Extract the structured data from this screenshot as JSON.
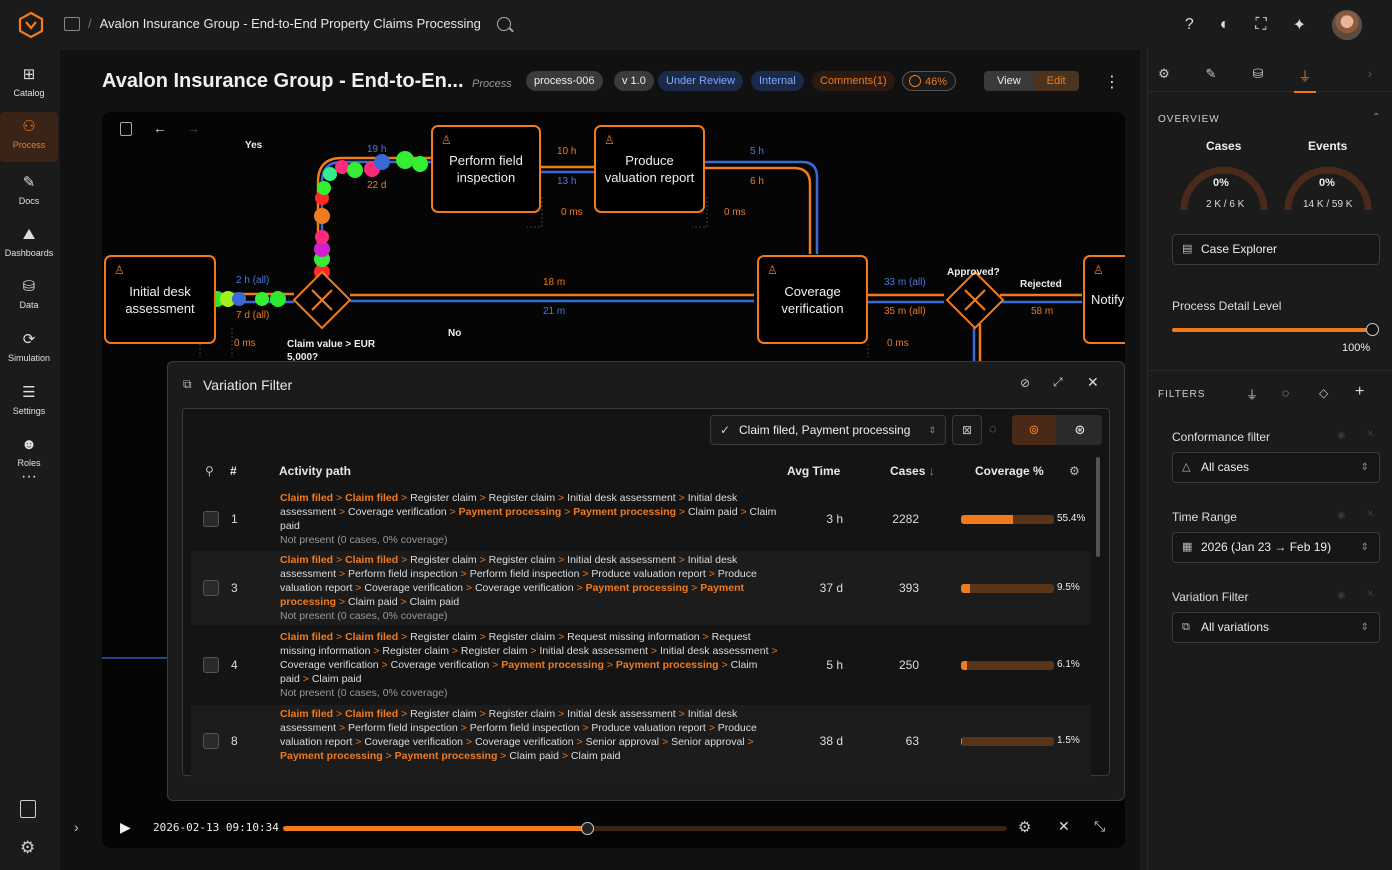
{
  "topbar": {
    "breadcrumb": "Avalon Insurance Group - End-to-End Property Claims Processing"
  },
  "nav": [
    {
      "label": "Catalog",
      "icon": "catalog-icon"
    },
    {
      "label": "Process",
      "icon": "process-icon"
    },
    {
      "label": "Docs",
      "icon": "docs-icon"
    },
    {
      "label": "Dashboards",
      "icon": "dashboards-icon"
    },
    {
      "label": "Data",
      "icon": "data-icon"
    },
    {
      "label": "Simulation",
      "icon": "simulation-icon"
    },
    {
      "label": "Settings",
      "icon": "settings-icon"
    },
    {
      "label": "Roles",
      "icon": "roles-icon"
    }
  ],
  "header": {
    "title": "Avalon Insurance Group - End-to-En...",
    "subtitle": "Process",
    "id_chip": "process-006",
    "version_chip": "v 1.0",
    "status_chip": "Under Review",
    "scope_chip": "Internal",
    "comments_chip": "Comments(1)",
    "progress_chip": "46%",
    "view_label": "View",
    "edit_label": "Edit"
  },
  "map": {
    "nodes": {
      "initial": "Initial desk assessment",
      "field": "Perform field inspection",
      "valuation": "Produce valuation report",
      "coverage": "Coverage verification",
      "notify": "Notify"
    },
    "labels": {
      "yes": "Yes",
      "no": "No",
      "gw1": "Claim value > EUR 5,000?",
      "gw2": "Approved?",
      "rejected": "Rejected",
      "l_19h": "19 h",
      "l_22d": "22 d",
      "l_10h": "10 h",
      "l_13h": "13 h",
      "l_0ms_a": "0 ms",
      "l_5h": "5 h",
      "l_6h": "6 h",
      "l_0ms_b": "0 ms",
      "l_2h": "2 h (all)",
      "l_7d": "7 d (all)",
      "l_0ms_c": "0 ms",
      "l_18m": "18 m",
      "l_21m": "21 m",
      "l_33m": "33 m (all)",
      "l_35m": "35 m (all)",
      "l_0ms_d": "0 ms",
      "l_58m": "58 m"
    }
  },
  "variation_filter": {
    "title": "Variation Filter",
    "selector": "Claim filed, Payment processing",
    "columns": {
      "num": "#",
      "path": "Activity path",
      "avg": "Avg Time",
      "cases": "Cases",
      "cases_sort": "↓",
      "coverage": "Coverage %"
    },
    "rows": [
      {
        "n": "1",
        "avg": "3 h",
        "cases": "2282",
        "coverage": 55.4,
        "coverage_label": "55.4%",
        "note": "Not present (0 cases, 0% coverage)",
        "path": [
          [
            "Claim filed",
            1
          ],
          [
            "Claim filed",
            1
          ],
          [
            "Register claim",
            0
          ],
          [
            "Register claim",
            0
          ],
          [
            "Initial desk assessment",
            0
          ],
          [
            "Initial desk assessment",
            0
          ],
          [
            "Coverage verification",
            0
          ],
          [
            "Payment processing",
            1
          ],
          [
            "Payment processing",
            1
          ],
          [
            "Claim paid",
            0
          ],
          [
            "Claim paid",
            0
          ]
        ]
      },
      {
        "n": "3",
        "avg": "37 d",
        "cases": "393",
        "coverage": 9.5,
        "coverage_label": "9.5%",
        "note": "Not present (0 cases, 0% coverage)",
        "path": [
          [
            "Claim filed",
            1
          ],
          [
            "Claim filed",
            1
          ],
          [
            "Register claim",
            0
          ],
          [
            "Register claim",
            0
          ],
          [
            "Initial desk assessment",
            0
          ],
          [
            "Initial desk assessment",
            0
          ],
          [
            "Perform field inspection",
            0
          ],
          [
            "Perform field inspection",
            0
          ],
          [
            "Produce valuation report",
            0
          ],
          [
            "Produce valuation report",
            0
          ],
          [
            "Coverage verification",
            0
          ],
          [
            "Coverage verification",
            0
          ],
          [
            "Payment processing",
            1
          ],
          [
            "Payment processing",
            1
          ],
          [
            "Claim paid",
            0
          ],
          [
            "Claim paid",
            0
          ]
        ]
      },
      {
        "n": "4",
        "avg": "5 h",
        "cases": "250",
        "coverage": 6.1,
        "coverage_label": "6.1%",
        "note": "Not present (0 cases, 0% coverage)",
        "path": [
          [
            "Claim filed",
            1
          ],
          [
            "Claim filed",
            1
          ],
          [
            "Register claim",
            0
          ],
          [
            "Register claim",
            0
          ],
          [
            "Request missing information",
            0
          ],
          [
            "Request missing information",
            0
          ],
          [
            "Register claim",
            0
          ],
          [
            "Register claim",
            0
          ],
          [
            "Initial desk assessment",
            0
          ],
          [
            "Initial desk assessment",
            0
          ],
          [
            "Coverage verification",
            0
          ],
          [
            "Coverage verification",
            0
          ],
          [
            "Payment processing",
            1
          ],
          [
            "Payment processing",
            1
          ],
          [
            "Claim paid",
            0
          ],
          [
            "Claim paid",
            0
          ]
        ]
      },
      {
        "n": "8",
        "avg": "38 d",
        "cases": "63",
        "coverage": 1.5,
        "coverage_label": "1.5%",
        "note": "",
        "path": [
          [
            "Claim filed",
            1
          ],
          [
            "Claim filed",
            1
          ],
          [
            "Register claim",
            0
          ],
          [
            "Register claim",
            0
          ],
          [
            "Initial desk assessment",
            0
          ],
          [
            "Initial desk assessment",
            0
          ],
          [
            "Perform field inspection",
            0
          ],
          [
            "Perform field inspection",
            0
          ],
          [
            "Produce valuation report",
            0
          ],
          [
            "Produce valuation report",
            0
          ],
          [
            "Coverage verification",
            0
          ],
          [
            "Coverage verification",
            0
          ],
          [
            "Senior approval",
            0
          ],
          [
            "Senior approval",
            0
          ],
          [
            "Payment processing",
            1
          ],
          [
            "Payment processing",
            1
          ],
          [
            "Claim paid",
            0
          ],
          [
            "Claim paid",
            0
          ]
        ]
      }
    ]
  },
  "player": {
    "timestamp": "2026-02-13 09:10:34",
    "progress": 0.42
  },
  "right_panel": {
    "overview": "OVERVIEW",
    "cases_title": "Cases",
    "cases_pct": "0%",
    "cases_sub": "2 K / 6 K",
    "events_title": "Events",
    "events_pct": "0%",
    "events_sub": "14 K / 59 K",
    "case_explorer": "Case Explorer",
    "detail_title": "Process Detail Level",
    "detail_value": "100%",
    "detail_level": 1.0,
    "filters": "FILTERS",
    "conformance_label": "Conformance filter",
    "conformance_value": "All cases",
    "time_label": "Time Range",
    "time_value": "2026 (Jan 23 → Feb 19)",
    "variation_label": "Variation Filter",
    "variation_value": "All variations"
  },
  "colors": {
    "accent": "#f07a1e",
    "blue": "#3a6ad8"
  }
}
